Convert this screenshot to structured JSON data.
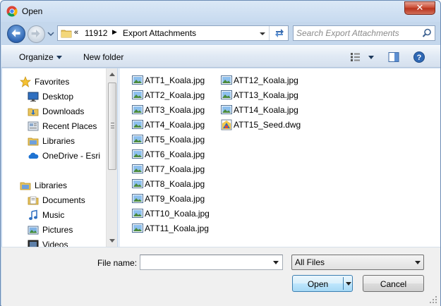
{
  "window": {
    "title": "Open",
    "close_label": "✕",
    "app_icon": "chrome-icon"
  },
  "address": {
    "overflow": "«",
    "path": [
      "11912",
      "Export Attachments"
    ],
    "separator": "▶"
  },
  "search": {
    "placeholder": "Search Export Attachments"
  },
  "toolbar": {
    "organize_label": "Organize",
    "new_folder_label": "New folder"
  },
  "nav": {
    "items": [
      {
        "label": "Favorites",
        "icon": "star-icon"
      },
      {
        "label": "Desktop",
        "icon": "desktop-icon"
      },
      {
        "label": "Downloads",
        "icon": "downloads-icon"
      },
      {
        "label": "Recent Places",
        "icon": "recent-places-icon"
      },
      {
        "label": "Libraries",
        "icon": "libraries-icon"
      },
      {
        "label": "OneDrive - Esri",
        "icon": "onedrive-icon"
      },
      {
        "label": "Libraries",
        "icon": "libraries-icon"
      },
      {
        "label": "Documents",
        "icon": "documents-icon"
      },
      {
        "label": "Music",
        "icon": "music-icon"
      },
      {
        "label": "Pictures",
        "icon": "pictures-icon"
      },
      {
        "label": "Videos",
        "icon": "videos-icon"
      }
    ]
  },
  "files": [
    {
      "name": "ATT1_Koala.jpg",
      "type": "jpg"
    },
    {
      "name": "ATT2_Koala.jpg",
      "type": "jpg"
    },
    {
      "name": "ATT3_Koala.jpg",
      "type": "jpg"
    },
    {
      "name": "ATT4_Koala.jpg",
      "type": "jpg"
    },
    {
      "name": "ATT5_Koala.jpg",
      "type": "jpg"
    },
    {
      "name": "ATT6_Koala.jpg",
      "type": "jpg"
    },
    {
      "name": "ATT7_Koala.jpg",
      "type": "jpg"
    },
    {
      "name": "ATT8_Koala.jpg",
      "type": "jpg"
    },
    {
      "name": "ATT9_Koala.jpg",
      "type": "jpg"
    },
    {
      "name": "ATT10_Koala.jpg",
      "type": "jpg"
    },
    {
      "name": "ATT11_Koala.jpg",
      "type": "jpg"
    },
    {
      "name": "ATT12_Koala.jpg",
      "type": "jpg"
    },
    {
      "name": "ATT13_Koala.jpg",
      "type": "jpg"
    },
    {
      "name": "ATT14_Koala.jpg",
      "type": "jpg"
    },
    {
      "name": "ATT15_Seed.dwg",
      "type": "dwg"
    }
  ],
  "bottom": {
    "file_name_label": "File name:",
    "file_name_value": "",
    "file_type_value": "All Files",
    "open_label": "Open",
    "cancel_label": "Cancel"
  },
  "colors": {
    "accent": "#3c7fb1",
    "frame": "#c4d7ec",
    "close": "#c7452d"
  }
}
